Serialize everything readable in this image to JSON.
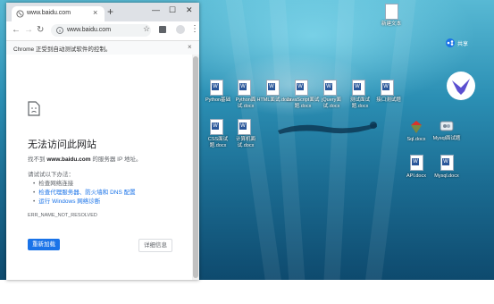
{
  "browser": {
    "tab_title": "www.baidu.com",
    "tab_close": "×",
    "new_tab": "+",
    "url": "www.baidu.com",
    "infobar_text": "Chrome 正受到自动测试软件的控制。",
    "infobar_close": "×",
    "error": {
      "title": "无法访问此网站",
      "desc_prefix": "找不到 ",
      "desc_host": "www.baidu.com",
      "desc_suffix": " 的服务器 IP 地址。",
      "try_label": "请试试以下办法：",
      "suggestions": [
        "检查网络连接",
        "检查代理服务器、防火墙和 DNS 配置",
        "运行 Windows 网络诊断"
      ],
      "code": "ERR_NAME_NOT_RESOLVED",
      "reload_label": "重新加载",
      "details_label": "详细信息"
    }
  },
  "desktop": {
    "share_label": "共享",
    "icons": [
      {
        "label": "新建文本",
        "type": "txt"
      },
      {
        "label": "Python基础",
        "type": "word"
      },
      {
        "label": "Python面试.docx",
        "type": "word"
      },
      {
        "label": "HTML面试.docx",
        "type": "word"
      },
      {
        "label": "JavaScript面试题.docx",
        "type": "word"
      },
      {
        "label": "jQuery面试.docx",
        "type": "word"
      },
      {
        "label": "测试面试题.docx",
        "type": "word"
      },
      {
        "label": "接口测试题",
        "type": "word"
      },
      {
        "label": "CSS面试题.docx",
        "type": "word"
      },
      {
        "label": "计算机面试.docx",
        "type": "word"
      },
      {
        "label": "Sql.docx",
        "type": "app"
      },
      {
        "label": "Mysql面试题",
        "type": "app"
      },
      {
        "label": "API.docx",
        "type": "word"
      },
      {
        "label": "Mysql.docx",
        "type": "word"
      }
    ]
  },
  "colors": {
    "accent": "#1a73e8",
    "word_blue": "#2b579a"
  }
}
